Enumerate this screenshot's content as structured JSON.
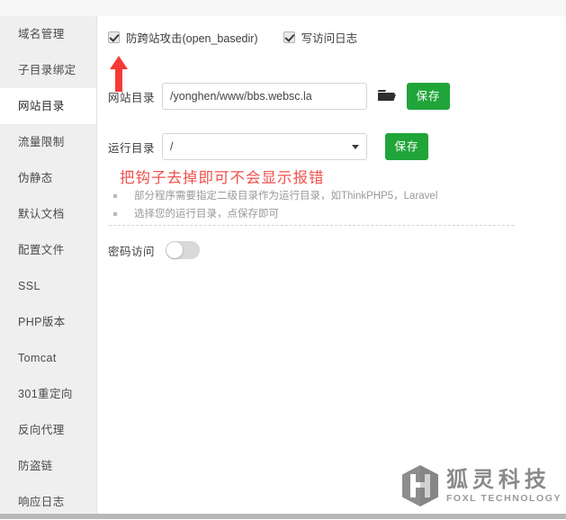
{
  "sidebar": {
    "items": [
      {
        "label": "域名管理",
        "active": false
      },
      {
        "label": "子目录绑定",
        "active": false
      },
      {
        "label": "网站目录",
        "active": true
      },
      {
        "label": "流量限制",
        "active": false
      },
      {
        "label": "伪静态",
        "active": false
      },
      {
        "label": "默认文档",
        "active": false
      },
      {
        "label": "配置文件",
        "active": false
      },
      {
        "label": "SSL",
        "active": false
      },
      {
        "label": "PHP版本",
        "active": false
      },
      {
        "label": "Tomcat",
        "active": false
      },
      {
        "label": "301重定向",
        "active": false
      },
      {
        "label": "反向代理",
        "active": false
      },
      {
        "label": "防盗链",
        "active": false
      },
      {
        "label": "响应日志",
        "active": false
      }
    ]
  },
  "options": {
    "anti_xss": {
      "label": "防跨站攻击(open_basedir)",
      "checked": true
    },
    "access_log": {
      "label": "写访问日志",
      "checked": true
    }
  },
  "site_dir": {
    "label": "网站目录",
    "value": "/yonghen/www/bbs.websc.la",
    "placeholder": "",
    "browse_icon": "folder-icon",
    "save_label": "保存"
  },
  "run_dir": {
    "label": "运行目录",
    "value": "/",
    "caret_icon": "chevron-down-icon",
    "save_label": "保存"
  },
  "annotation": {
    "text": "把钩子去掉即可不会显示报错",
    "color": "#f0504b",
    "arrow_icon": "up-arrow-icon"
  },
  "tips": [
    "部分程序需要指定二级目录作为运行目录，如ThinkPHP5，Laravel",
    "选择您的运行目录，点保存即可"
  ],
  "password_access": {
    "label": "密码访问",
    "enabled": false
  },
  "logo": {
    "mark_icon": "foxl-hexagon-logo-icon",
    "cn": "狐灵科技",
    "en": "FOXL TECHNOLOGY"
  },
  "colors": {
    "accent_green": "#20a53a",
    "annotation_red": "#f0504b",
    "sidebar_bg": "#efefef",
    "logo_gray": "#8a8a8a"
  }
}
